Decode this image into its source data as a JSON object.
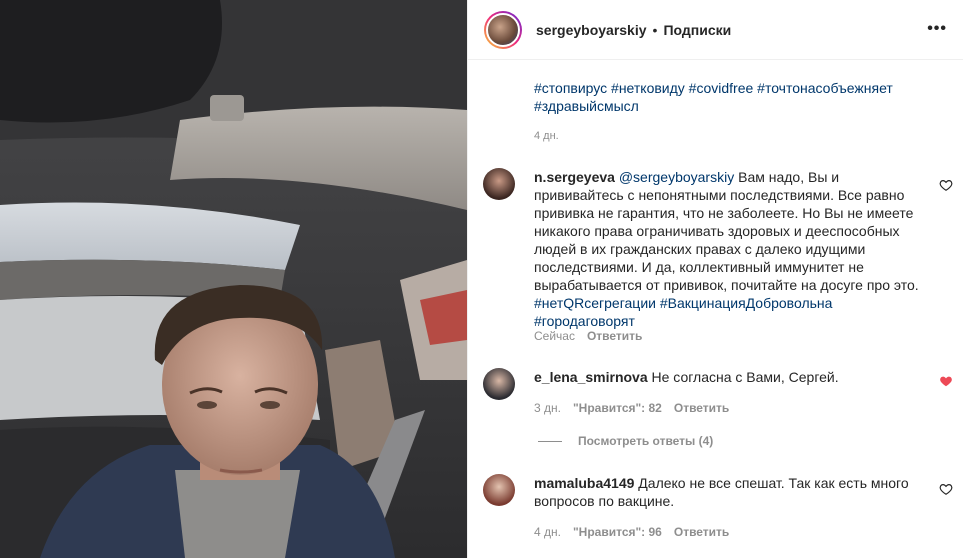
{
  "post": {
    "username": "sergeyboyarskiy",
    "separator": "•",
    "follow_label": "Подписки",
    "more_label": "•••"
  },
  "caption": {
    "tag_1": "#стопвирус",
    "tag_2": "#нетковиду",
    "tag_3": "#covidfree",
    "tag_4": "#точтонасобъежняет",
    "tag_5": "#здравыйсмысл",
    "time": "4 дн."
  },
  "comments": [
    {
      "username": "n.sergeyeva",
      "mention": "@sergeyboyarskiy",
      "text": "Вам надо, Вы и прививайтесь с непонятными последствиями. Все равно прививка не гарантия, что не заболеете. Но Вы не имеете никакого права ограничивать здоровых и дееспособных людей в их гражданских правах с далеко идущими последствиями. И да, коллективный иммунитет не вырабатывается от прививок, почитайте на досуге про это.",
      "tag_1": "#нетQRсегрегации",
      "tag_2": "#ВакцинацияДобровольна",
      "tag_3": "#городаговорят",
      "time": "Сейчас",
      "reply_label": "Ответить",
      "liked": false
    },
    {
      "username": "e_lena_smirnova",
      "text": "Не согласна с Вами, Сергей.",
      "time": "3 дн.",
      "likes_label": "\"Нравится\": 82",
      "reply_label": "Ответить",
      "liked": true,
      "view_replies": "Посмотреть ответы (4)"
    },
    {
      "username": "mamaluba4149",
      "text": "Далеко не все спешат. Так как есть много вопросов по вакцине.",
      "time": "4 дн.",
      "likes_label": "\"Нравится\": 96",
      "reply_label": "Ответить",
      "liked": false
    }
  ],
  "colors": {
    "tag": "#00376b",
    "heart_liked": "#ed4956",
    "muted": "#8e8e8e"
  }
}
